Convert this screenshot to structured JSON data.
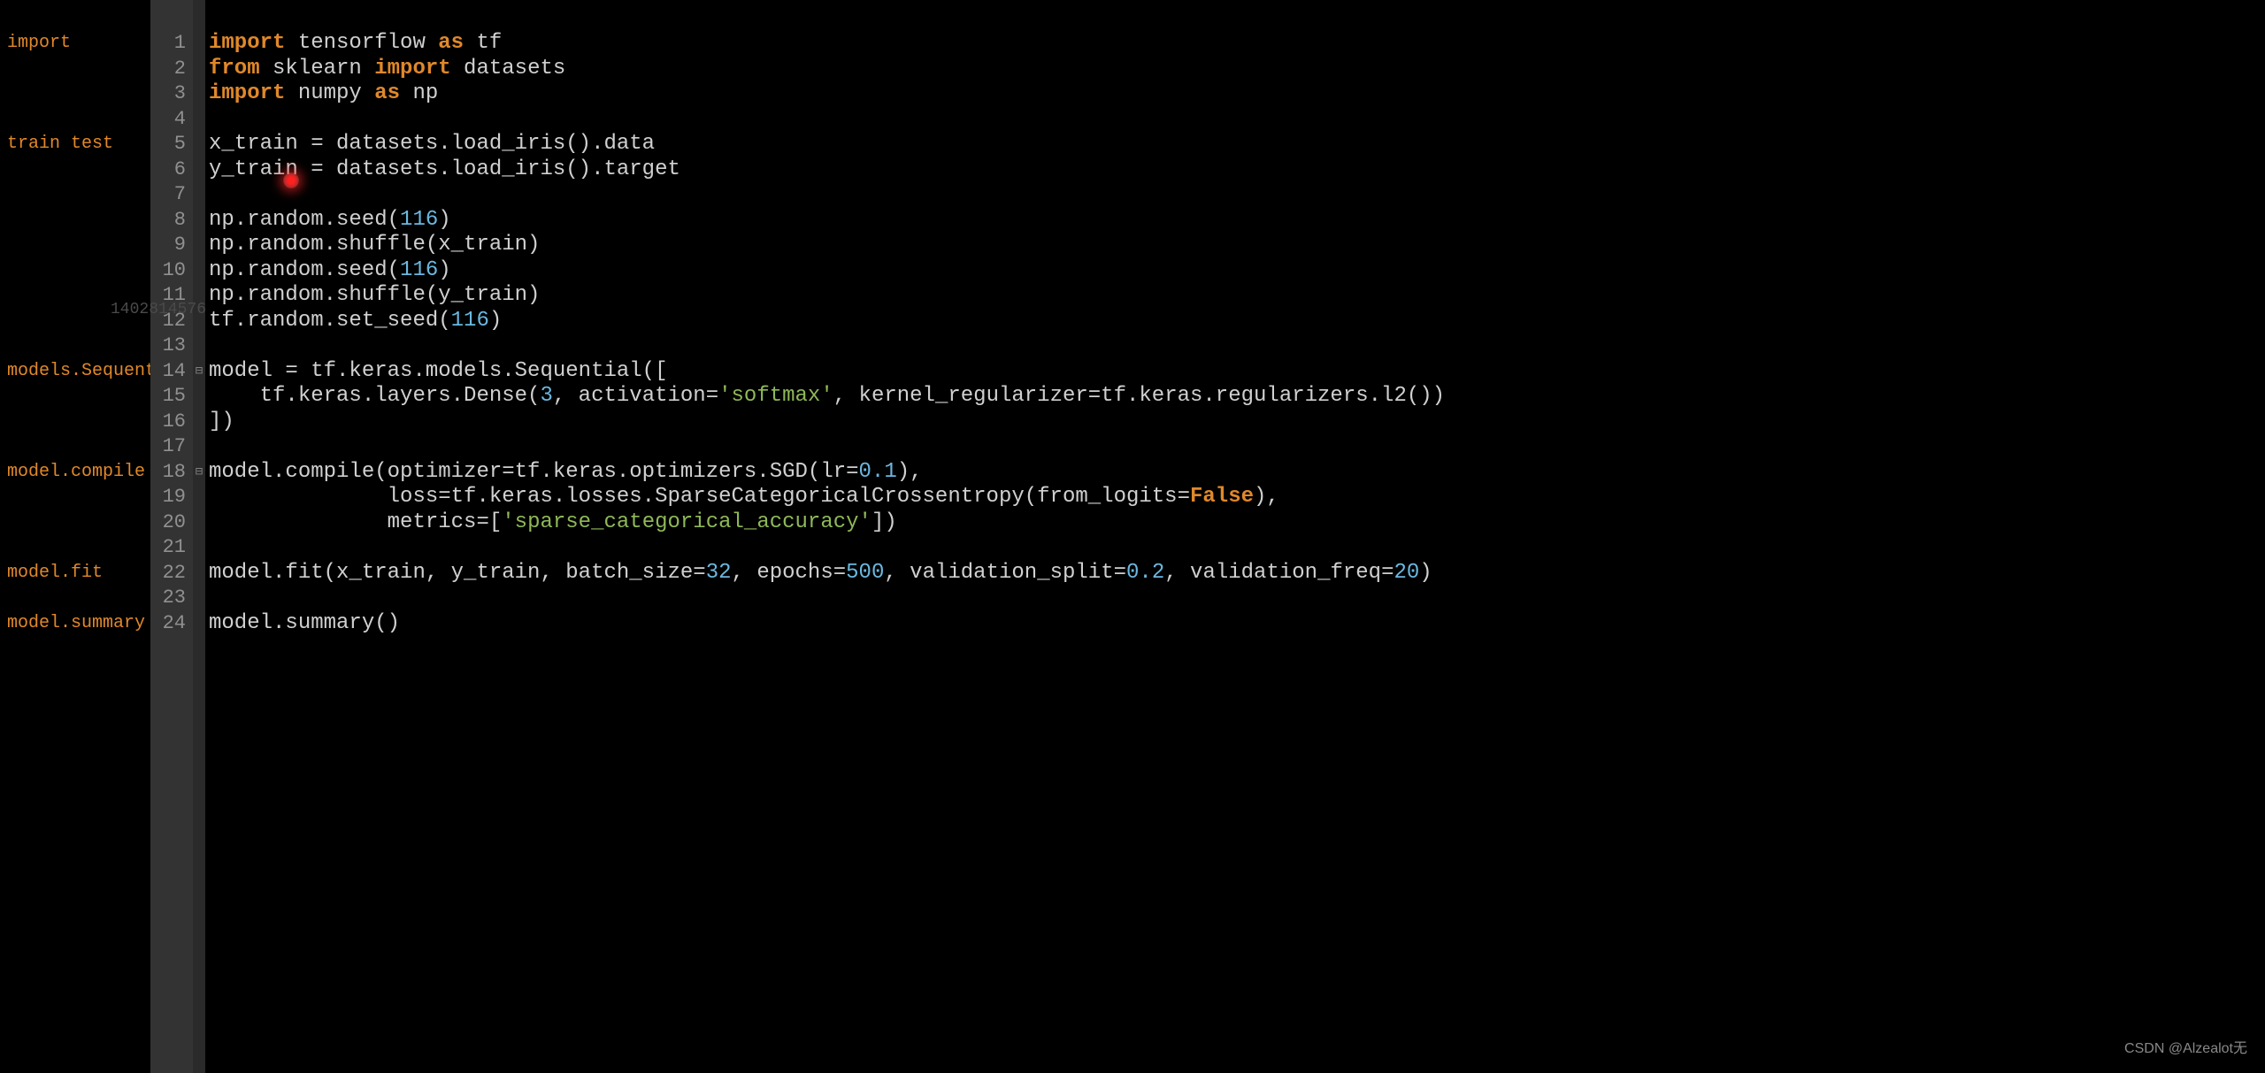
{
  "annotations": [
    {
      "line": 1,
      "text": "import"
    },
    {
      "line": 5,
      "text": "train  test"
    },
    {
      "line": 14,
      "text": "models.Sequential"
    },
    {
      "line": 18,
      "text": "model.compile"
    },
    {
      "line": 22,
      "text": "model.fit"
    },
    {
      "line": 24,
      "text": "model.summary"
    }
  ],
  "line_count": 24,
  "fold_lines": [
    14,
    18
  ],
  "code": {
    "l1": [
      {
        "t": "import",
        "c": "kwbold"
      },
      {
        "t": " tensorflow ",
        "c": "id"
      },
      {
        "t": "as",
        "c": "kwbold"
      },
      {
        "t": " tf",
        "c": "id"
      }
    ],
    "l2": [
      {
        "t": "from",
        "c": "kwbold"
      },
      {
        "t": " sklearn ",
        "c": "id"
      },
      {
        "t": "import",
        "c": "kwbold"
      },
      {
        "t": " datasets",
        "c": "id"
      }
    ],
    "l3": [
      {
        "t": "import",
        "c": "kwbold"
      },
      {
        "t": " numpy ",
        "c": "id"
      },
      {
        "t": "as",
        "c": "kwbold"
      },
      {
        "t": " np",
        "c": "id"
      }
    ],
    "l4": [],
    "l5": [
      {
        "t": "x_train = datasets.load_iris().data",
        "c": "id"
      }
    ],
    "l6": [
      {
        "t": "y_train = datasets.load_iris().target",
        "c": "id"
      }
    ],
    "l7": [],
    "l8": [
      {
        "t": "np.random.seed(",
        "c": "id"
      },
      {
        "t": "116",
        "c": "num"
      },
      {
        "t": ")",
        "c": "id"
      }
    ],
    "l9": [
      {
        "t": "np.random.shuffle(x_train)",
        "c": "id"
      }
    ],
    "l10": [
      {
        "t": "np.random.seed(",
        "c": "id"
      },
      {
        "t": "116",
        "c": "num"
      },
      {
        "t": ")",
        "c": "id"
      }
    ],
    "l11": [
      {
        "t": "np.random.shuffle(y_train)",
        "c": "id"
      }
    ],
    "l12": [
      {
        "t": "tf.random.set_seed(",
        "c": "id"
      },
      {
        "t": "116",
        "c": "num"
      },
      {
        "t": ")",
        "c": "id"
      }
    ],
    "l13": [],
    "l14": [
      {
        "t": "model = tf.keras.models.Sequential([",
        "c": "id"
      }
    ],
    "l15": [
      {
        "t": "    tf.keras.layers.Dense(",
        "c": "id"
      },
      {
        "t": "3",
        "c": "num"
      },
      {
        "t": ", activation=",
        "c": "id"
      },
      {
        "t": "'softmax'",
        "c": "str"
      },
      {
        "t": ", kernel_regularizer=tf.keras.regularizers.l2())",
        "c": "id"
      }
    ],
    "l16": [
      {
        "t": "])",
        "c": "id"
      }
    ],
    "l17": [],
    "l18": [
      {
        "t": "model.compile(optimizer=tf.keras.optimizers.SGD(lr=",
        "c": "id"
      },
      {
        "t": "0.1",
        "c": "num"
      },
      {
        "t": "),",
        "c": "id"
      }
    ],
    "l19": [
      {
        "t": "              loss=tf.keras.losses.SparseCategoricalCrossentropy(from_logits=",
        "c": "id"
      },
      {
        "t": "False",
        "c": "const"
      },
      {
        "t": "),",
        "c": "id"
      }
    ],
    "l20": [
      {
        "t": "              metrics=[",
        "c": "id"
      },
      {
        "t": "'sparse_categorical_accuracy'",
        "c": "str"
      },
      {
        "t": "])",
        "c": "id"
      }
    ],
    "l21": [],
    "l22": [
      {
        "t": "model.fit(x_train, y_train, batch_size=",
        "c": "id"
      },
      {
        "t": "32",
        "c": "num"
      },
      {
        "t": ", epochs=",
        "c": "id"
      },
      {
        "t": "500",
        "c": "num"
      },
      {
        "t": ", validation_split=",
        "c": "id"
      },
      {
        "t": "0.2",
        "c": "num"
      },
      {
        "t": ", validation_freq=",
        "c": "id"
      },
      {
        "t": "20",
        "c": "num"
      },
      {
        "t": ")",
        "c": "id"
      }
    ],
    "l23": [],
    "l24": [
      {
        "t": "model.summary()",
        "c": "id"
      }
    ]
  },
  "watermark_faded": "1402814576",
  "watermark_bottom": "CSDN @Alzealot无"
}
